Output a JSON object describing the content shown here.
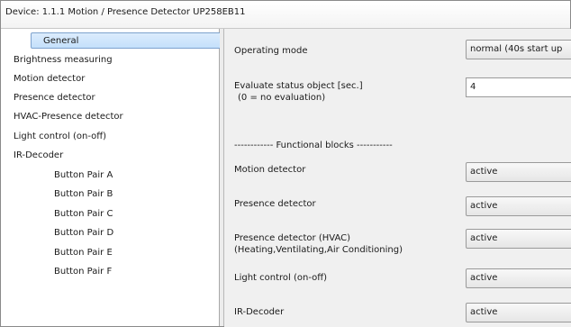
{
  "window": {
    "title": "Device: 1.1.1  Motion / Presence Detector UP258EB11"
  },
  "sidebar": {
    "items": [
      {
        "label": "General",
        "selected": true
      },
      {
        "label": "Brightness measuring"
      },
      {
        "label": "Motion detector"
      },
      {
        "label": "Presence detector"
      },
      {
        "label": "HVAC-Presence detector"
      },
      {
        "label": "Light control (on-off)"
      },
      {
        "label": "IR-Decoder"
      },
      {
        "label": "Button Pair A"
      },
      {
        "label": "Button Pair B"
      },
      {
        "label": "Button Pair C"
      },
      {
        "label": "Button Pair D"
      },
      {
        "label": "Button Pair E"
      },
      {
        "label": "Button Pair F"
      }
    ]
  },
  "main": {
    "operating_mode": {
      "label": "Operating mode",
      "value": "normal (40s start up"
    },
    "evaluate_status": {
      "label_line1": "Evaluate status object [sec.]",
      "label_line2": "(0 = no evaluation)",
      "value": "4"
    },
    "functional_blocks_header": "------------ Functional blocks -----------",
    "motion_detector": {
      "label": "Motion detector",
      "value": "active"
    },
    "presence_detector": {
      "label": "Presence detector",
      "value": "active"
    },
    "presence_hvac": {
      "label_line1": "Presence detector  (HVAC)",
      "label_line2": "(Heating,Ventilating,Air Conditioning)",
      "value": "active"
    },
    "light_control": {
      "label": "Light control (on-off)",
      "value": "active"
    },
    "ir_decoder": {
      "label": "IR-Decoder",
      "value": "active"
    }
  }
}
